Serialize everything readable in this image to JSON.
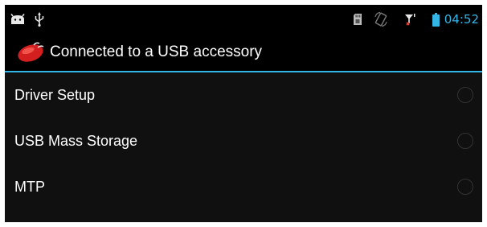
{
  "status_bar": {
    "left_icons": [
      "android-notification-icon",
      "usb-icon"
    ],
    "right_icons": [
      "sd-card-icon",
      "screen-rotation-icon",
      "no-signal-icon",
      "battery-icon"
    ],
    "time": "04:52",
    "accent_color": "#33b5e5"
  },
  "dialog": {
    "icon": "usb-accessory-icon",
    "title": "Connected to a USB accessory",
    "options": [
      {
        "label": "Driver Setup",
        "selected": false
      },
      {
        "label": "USB Mass Storage",
        "selected": false
      },
      {
        "label": "MTP",
        "selected": false
      }
    ]
  }
}
